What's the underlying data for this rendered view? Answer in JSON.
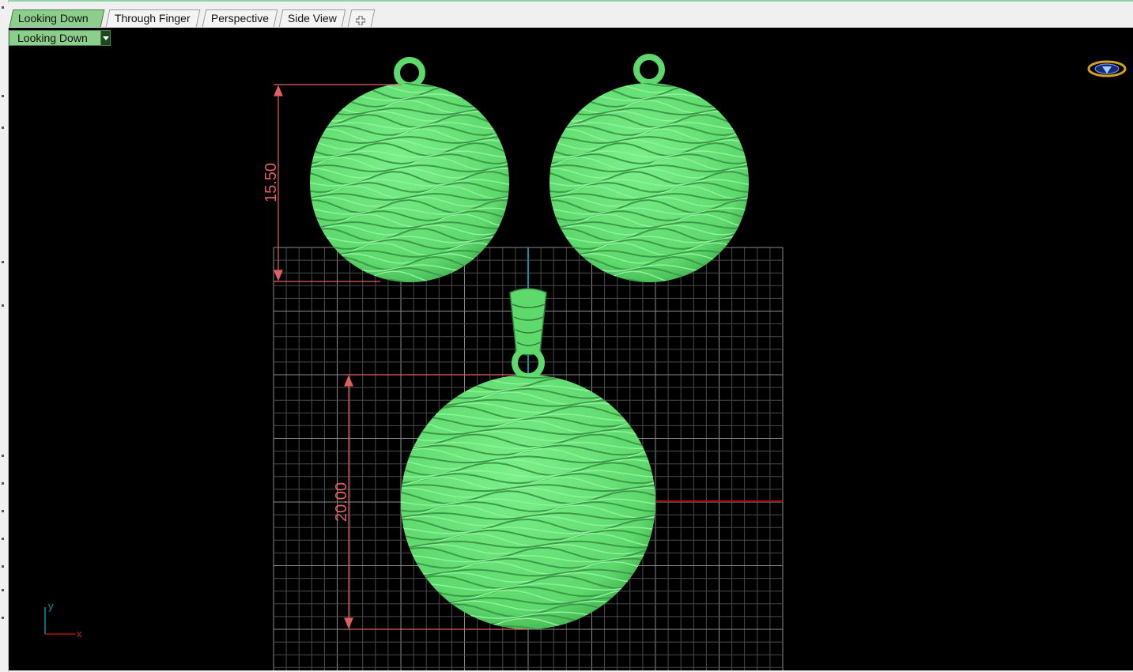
{
  "tabs": [
    {
      "label": "Looking Down",
      "active": true
    },
    {
      "label": "Through Finger",
      "active": false
    },
    {
      "label": "Perspective",
      "active": false
    },
    {
      "label": "Side View",
      "active": false
    }
  ],
  "add_tab_icon": "plus-icon",
  "viewport": {
    "label": "Looking Down",
    "dropdown_icon": "chevron-down-icon"
  },
  "dimensions": {
    "earring_height": "15.50",
    "pendant_height": "20.00"
  },
  "axis_widget": {
    "y": "y",
    "x": "x"
  },
  "nav_icon": "orbit-navigator-icon",
  "colors": {
    "model": "#6ee57a",
    "dimension": "#e06060",
    "grid": "#6a6a6a",
    "x_axis": "#b01010",
    "y_axis": "#1a8ca0",
    "active_tab": "#8ccf8c"
  }
}
